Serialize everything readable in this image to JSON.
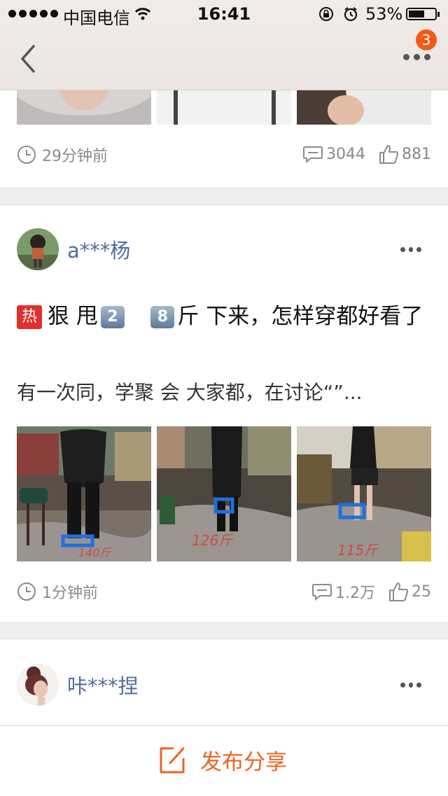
{
  "status_bar": {
    "carrier": "中国电信",
    "time": "16:41",
    "battery": "53%"
  },
  "nav": {
    "badge_count": "3"
  },
  "posts": [
    {
      "time_ago": "29分钟前",
      "comments": "3044",
      "likes": "881"
    },
    {
      "author": "a***杨",
      "hot_label": "热",
      "title_part1": "狠  甩",
      "key1": "2",
      "key2": "8",
      "title_part2": "斤  下来，怎样穿都好看了",
      "snippet": "有一次同，学聚   会  大家都，在讨论“”...",
      "image_captions": [
        "140斤",
        "126斤",
        "115斤"
      ],
      "time_ago": "1分钟前",
      "comments": "1.2万",
      "likes": "25"
    },
    {
      "author": "咔***捏"
    }
  ],
  "bottom_bar": {
    "publish_label": "发布分享"
  },
  "colors": {
    "accent": "#ec6520",
    "badge": "#f25a16",
    "hot": "#e0302c",
    "author": "#4f6d99"
  }
}
